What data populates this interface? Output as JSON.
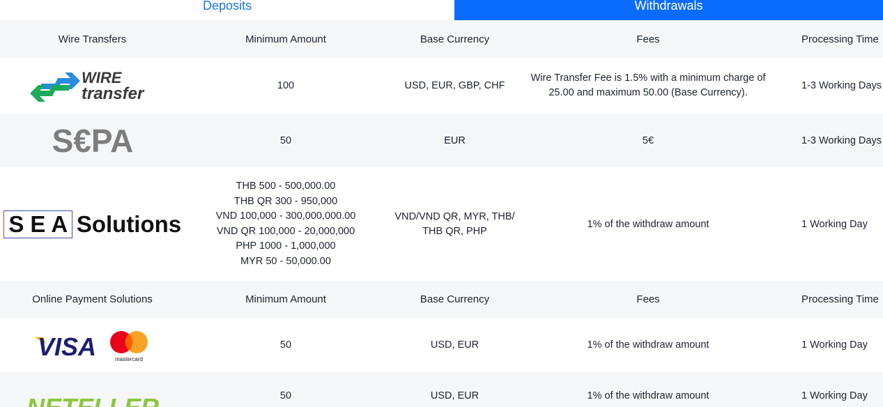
{
  "tabs": {
    "deposits": "Deposits",
    "withdrawals": "Withdrawals"
  },
  "section1": {
    "header": [
      "Wire Transfers",
      "Minimum Amount",
      "Base Currency",
      "Fees",
      "Processing Time"
    ],
    "rows": [
      {
        "logo": "wire-transfer",
        "logo_text_1": "WIRE",
        "logo_text_2": "transfer",
        "min": "100",
        "currency": "USD, EUR, GBP, CHF",
        "fees": [
          "Wire Transfer Fee is 1.5% with a minimum charge of",
          "25.00 and maximum 50.00 (Base Currency)."
        ],
        "time": "1-3 Working Days"
      },
      {
        "logo": "sepa",
        "logo_text": "S€PA",
        "min": "50",
        "currency": "EUR",
        "fees": [
          "5€"
        ],
        "time": "1-3 Working Days"
      },
      {
        "logo": "sea-solutions",
        "logo_letters": [
          "S",
          "E",
          "A"
        ],
        "logo_word": "Solutions",
        "min": [
          "THB 500 - 500,000.00",
          "THB QR 300 - 950,000",
          "VND 100,000 - 300,000,000.00",
          "VND QR 100,000 - 20,000,000",
          "PHP 1000 - 1,000,000",
          "MYR 50 - 50,000.00"
        ],
        "currency": [
          "VND/VND QR, MYR, THB/",
          "THB QR, PHP"
        ],
        "fees": [
          "1% of the withdraw amount"
        ],
        "time": "1 Working Day"
      }
    ]
  },
  "section2": {
    "header": [
      "Online Payment Solutions",
      "Minimum Amount",
      "Base Currency",
      "Fees",
      "Processing Time"
    ],
    "rows": [
      {
        "logo": "visa-mastercard",
        "visa_text": "VISA",
        "mc_text": "mastercard",
        "min": "50",
        "currency": "USD, EUR",
        "fees": "1% of the withdraw amount",
        "time": "1 Working Day"
      },
      {
        "logo": "neteller",
        "logo_text": "NETELLER",
        "min": "50",
        "currency": "USD, EUR",
        "fees": "1% of the withdraw amount",
        "time": "1 Working Day"
      }
    ]
  },
  "colors": {
    "accent": "#0a6cff",
    "tab_text": "#1a73e8",
    "band": "#f5f6f7",
    "wire_green": "#1cab5a",
    "wire_blue": "#2a8be0",
    "visa_blue": "#1a1f71",
    "visa_gold": "#f7a600",
    "mc_red": "#eb001b",
    "mc_orange": "#f79e1b",
    "neteller_green": "#8dc63f",
    "sepa_gray": "#7d7d7d"
  }
}
